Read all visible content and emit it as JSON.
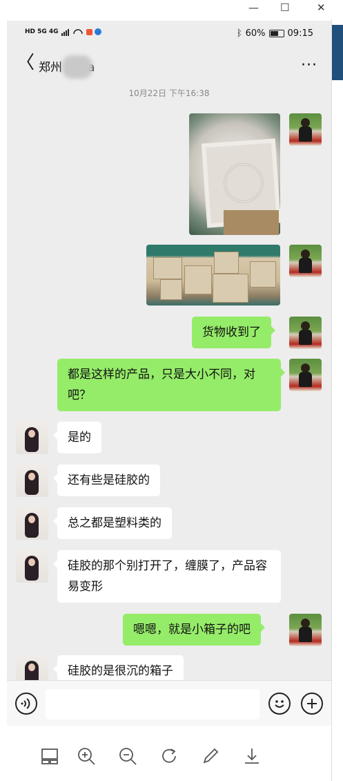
{
  "window": {
    "minimize_glyph": "—",
    "maximize_glyph": "☐",
    "close_glyph": "✕"
  },
  "status_bar": {
    "signal_labels": "HD 5G 4G",
    "battery": "60%",
    "time": "09:15"
  },
  "header": {
    "back_glyph": "〈",
    "title": "郑州   Bella",
    "more_glyph": "···"
  },
  "chat": {
    "timestamp": "10月22日 下午16:38",
    "messages": [
      {
        "side": "sent",
        "type": "image",
        "name": "photo-plastic-mold"
      },
      {
        "side": "sent",
        "type": "image",
        "name": "photo-cardboard-boxes"
      },
      {
        "side": "sent",
        "type": "text",
        "text": "货物收到了"
      },
      {
        "side": "sent",
        "type": "text",
        "text": "都是这样的产品，只是大小不同，对吧？"
      },
      {
        "side": "recv",
        "type": "text",
        "text": "是的"
      },
      {
        "side": "recv",
        "type": "text",
        "text": "还有些是硅胶的"
      },
      {
        "side": "recv",
        "type": "text",
        "text": "总之都是塑料类的"
      },
      {
        "side": "recv",
        "type": "text",
        "text": "硅胶的那个别打开了，缠膜了，产品容易变形"
      },
      {
        "side": "sent",
        "type": "text",
        "text": "嗯嗯，就是小箱子的吧"
      },
      {
        "side": "recv",
        "type": "text",
        "text": "硅胶的是很沉的箱子"
      }
    ]
  },
  "input_bar": {
    "voice_icon": "voice-icon",
    "emoji_icon": "emoji-icon",
    "plus_icon": "plus-icon"
  },
  "viewer_toolbar": {
    "icons": [
      "layout-icon",
      "zoom-in-icon",
      "zoom-out-icon",
      "rotate-icon",
      "edit-icon",
      "download-icon"
    ]
  },
  "colors": {
    "sent_bubble": "#95ec69",
    "recv_bubble": "#ffffff",
    "chat_background": "#ededed"
  }
}
